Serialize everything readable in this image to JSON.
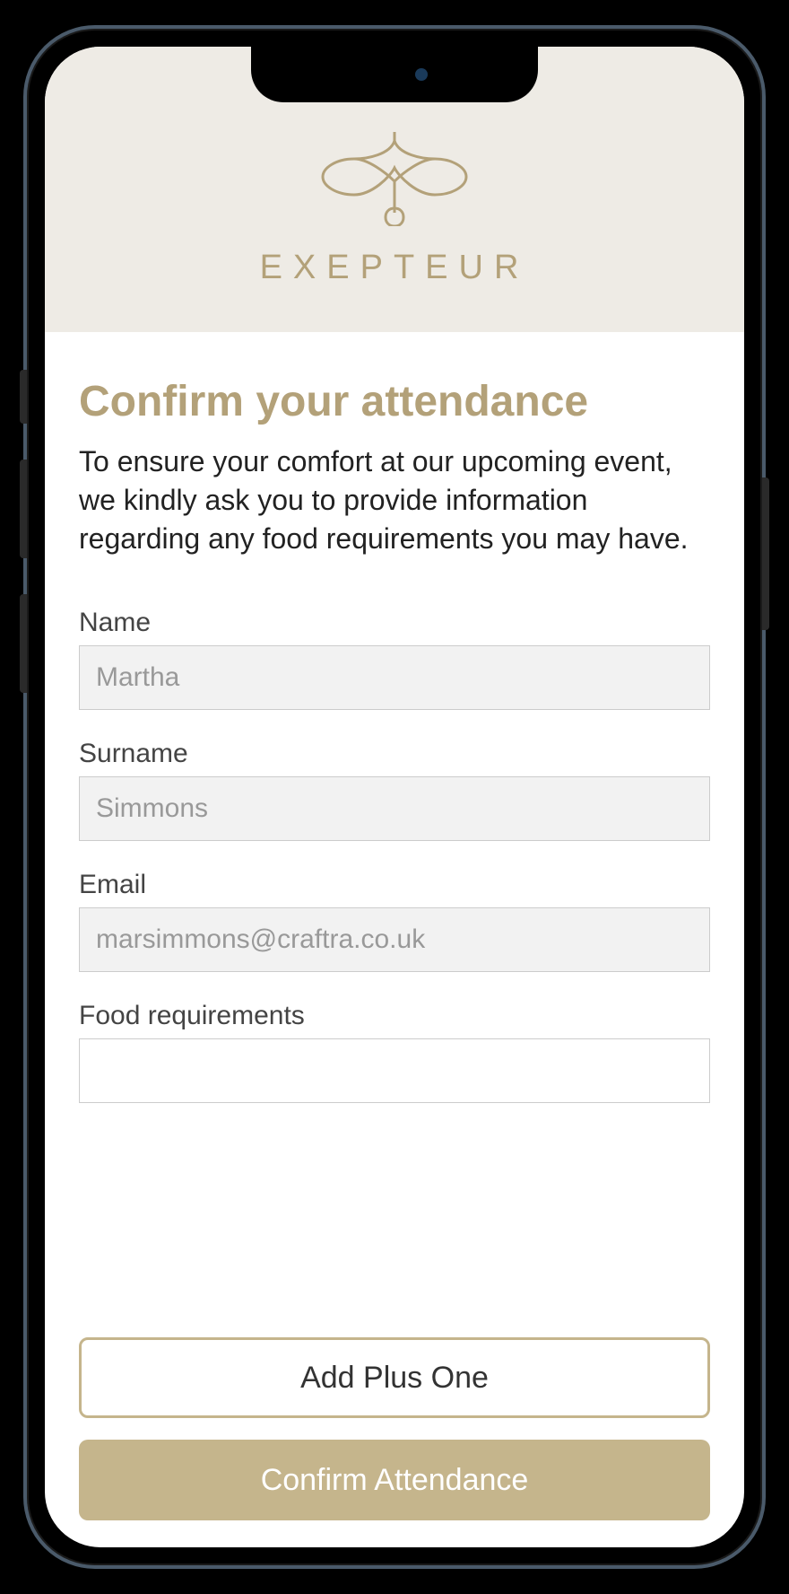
{
  "header": {
    "brand_name": "EXEPTEUR"
  },
  "main": {
    "title": "Confirm your attendance",
    "description": "To ensure your comfort at our upcoming event, we kindly ask you to provide information regarding any food requirements you may have.",
    "fields": {
      "name": {
        "label": "Name",
        "placeholder": "Martha",
        "value": ""
      },
      "surname": {
        "label": "Surname",
        "placeholder": "Simmons",
        "value": ""
      },
      "email": {
        "label": "Email",
        "placeholder": "marsimmons@craftra.co.uk",
        "value": ""
      },
      "food": {
        "label": "Food requirements",
        "placeholder": "",
        "value": ""
      }
    },
    "buttons": {
      "add_plus_one": "Add Plus One",
      "confirm": "Confirm Attendance"
    }
  },
  "colors": {
    "accent": "#b3a179",
    "button_primary": "#c5b58c",
    "header_bg": "#eeebe5"
  }
}
